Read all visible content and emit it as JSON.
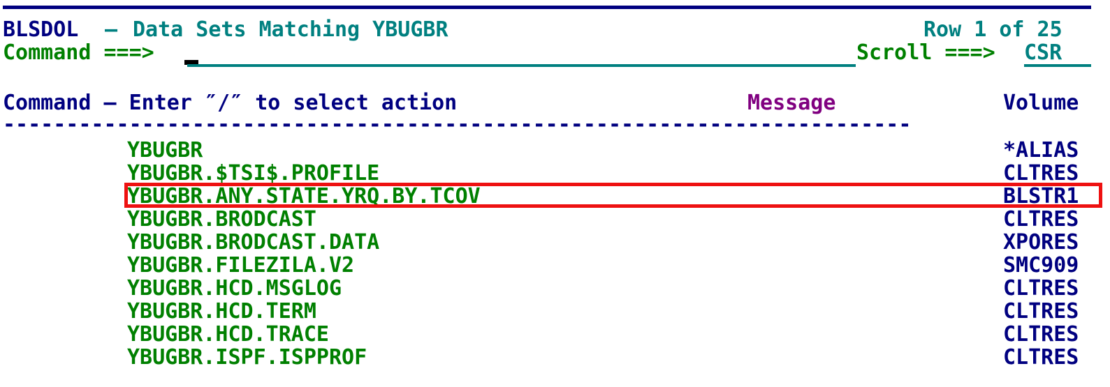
{
  "header": {
    "panel_id": "BLSDOL",
    "dash": "–",
    "title": "Data Sets Matching YBUGBR",
    "row_indicator": "Row 1 of 25"
  },
  "command_line": {
    "label": "Command ===>",
    "value": "",
    "scroll_label": "Scroll ===>",
    "scroll_value": "CSR"
  },
  "columns": {
    "command": "Command – Enter ″/″ to select action",
    "message": "Message",
    "volume": "Volume",
    "separator": "------------------------------------------------------------------------"
  },
  "colors": {
    "panel_id": "#000080",
    "title": "#008080",
    "command_label": "#008000",
    "row_indicator": "#008080",
    "column_header": "#000080",
    "message_header": "#800080",
    "dataset_name": "#008000",
    "volume_value": "#000080",
    "highlight": "#ee1111",
    "cursor": "#000000",
    "input_underline": "#008080"
  },
  "rows": [
    {
      "name": "YBUGBR",
      "message": "",
      "volume": "*ALIAS",
      "selected": false
    },
    {
      "name": "YBUGBR.$TSI$.PROFILE",
      "message": "",
      "volume": "CLTRES",
      "selected": false
    },
    {
      "name": "YBUGBR.ANY.STATE.YRQ.BY.TCOV",
      "message": "",
      "volume": "BLSTR1",
      "selected": true
    },
    {
      "name": "YBUGBR.BRODCAST",
      "message": "",
      "volume": "CLTRES",
      "selected": false
    },
    {
      "name": "YBUGBR.BRODCAST.DATA",
      "message": "",
      "volume": "XPORES",
      "selected": false
    },
    {
      "name": "YBUGBR.FILEZILA.V2",
      "message": "",
      "volume": "SMC909",
      "selected": false
    },
    {
      "name": "YBUGBR.HCD.MSGLOG",
      "message": "",
      "volume": "CLTRES",
      "selected": false
    },
    {
      "name": "YBUGBR.HCD.TERM",
      "message": "",
      "volume": "CLTRES",
      "selected": false
    },
    {
      "name": "YBUGBR.HCD.TRACE",
      "message": "",
      "volume": "CLTRES",
      "selected": false
    },
    {
      "name": "YBUGBR.ISPF.ISPPROF",
      "message": "",
      "volume": "CLTRES",
      "selected": false
    }
  ]
}
